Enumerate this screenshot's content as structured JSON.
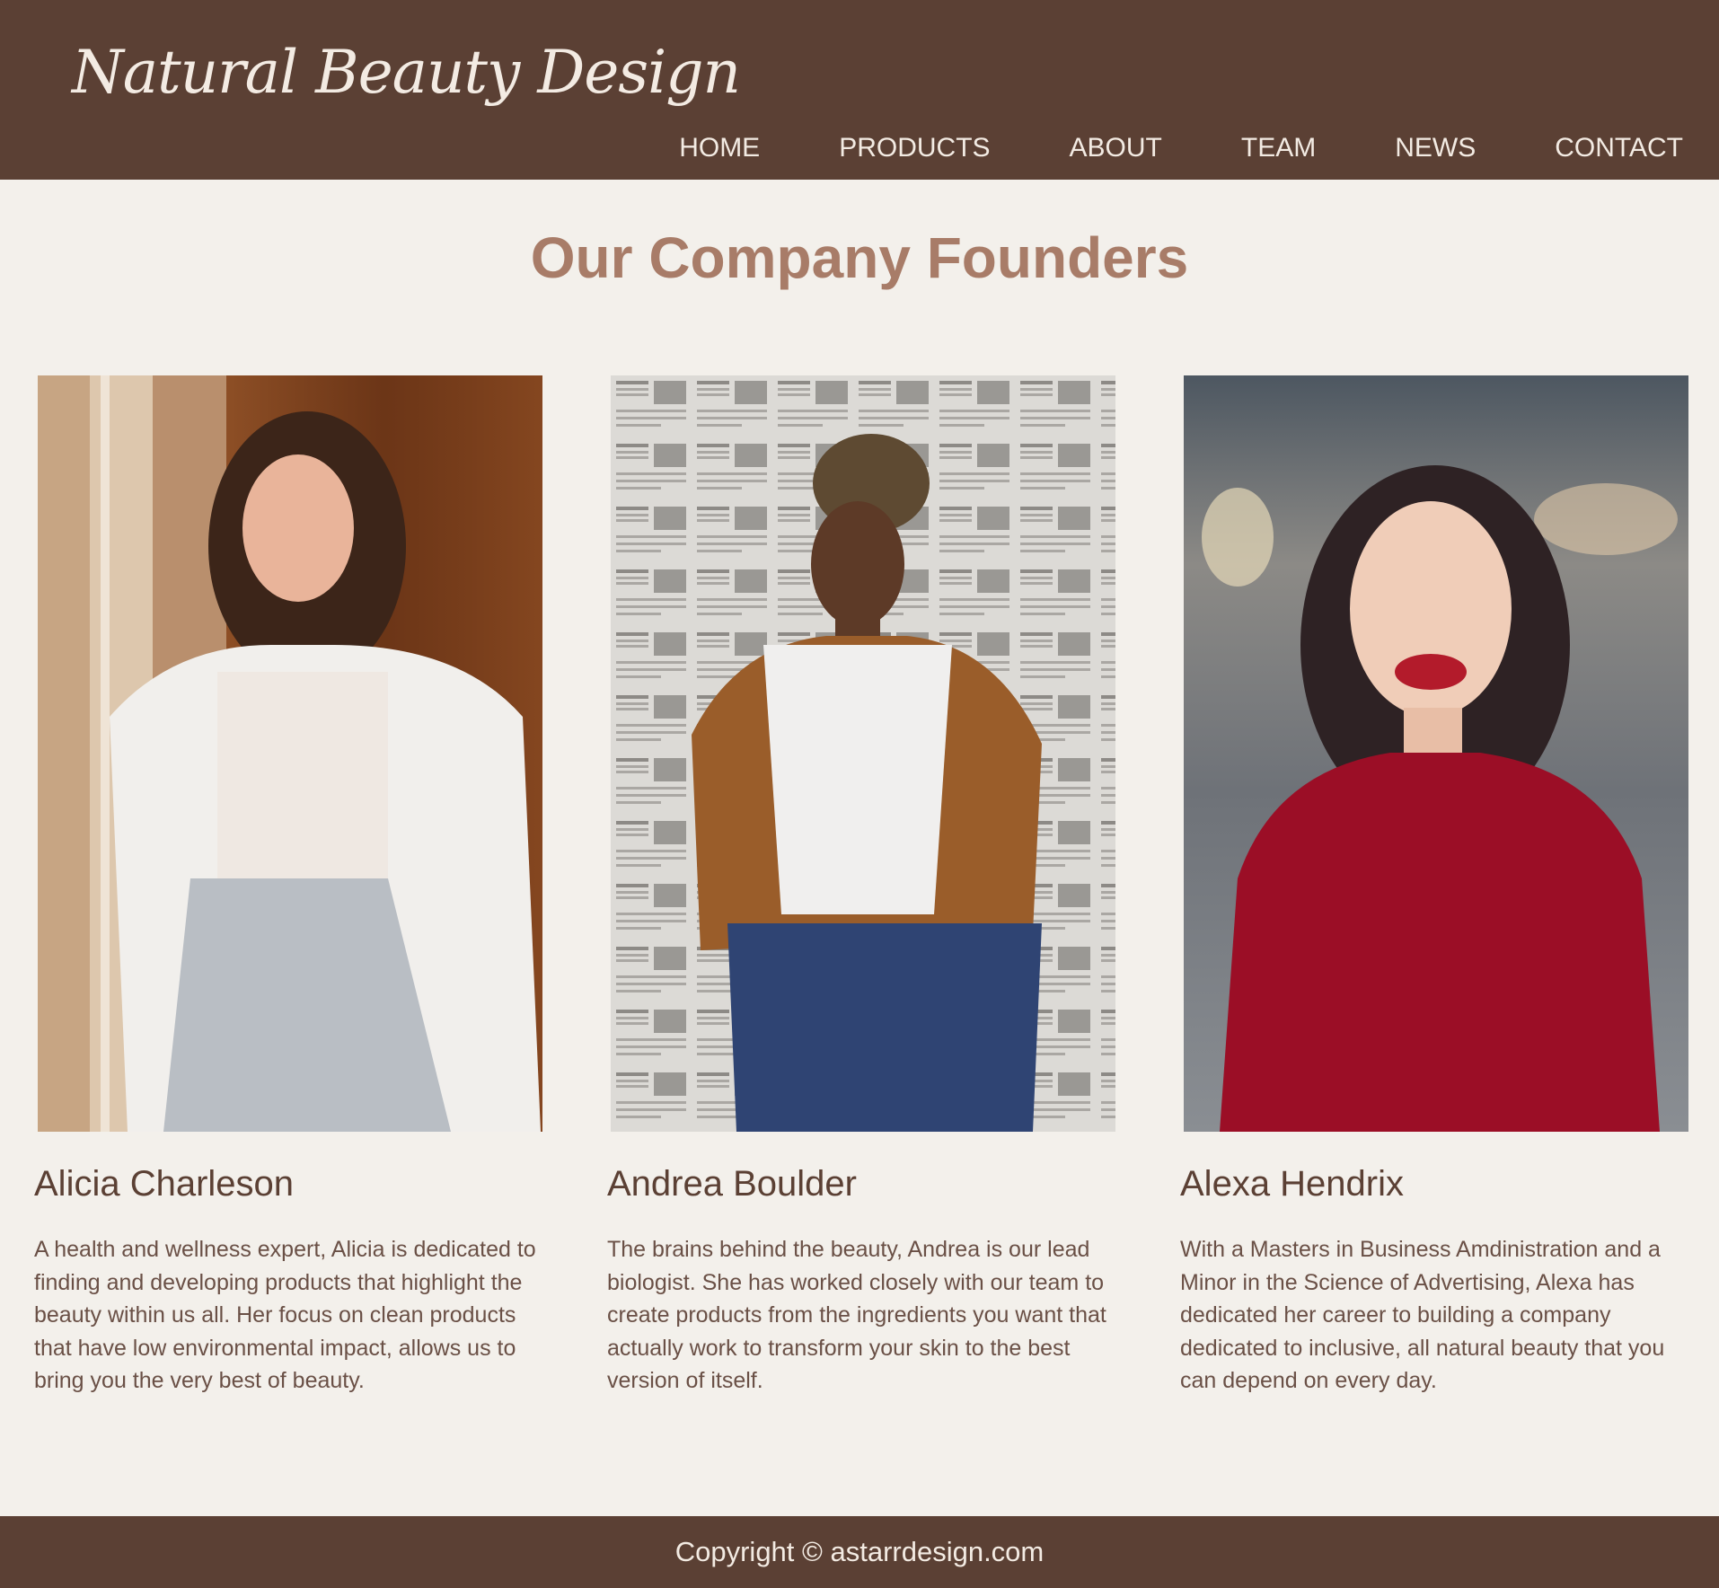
{
  "brand": {
    "logo_text": "Natural Beauty Design"
  },
  "nav": {
    "items": [
      {
        "label": "HOME"
      },
      {
        "label": "PRODUCTS"
      },
      {
        "label": "ABOUT"
      },
      {
        "label": "TEAM"
      },
      {
        "label": "NEWS"
      },
      {
        "label": "CONTACT"
      }
    ]
  },
  "main": {
    "title": "Our Company Founders",
    "founders": [
      {
        "name": "Alicia Charleson",
        "bio": "A health and wellness expert, Alicia is dedicated to finding and developing products that highlight the beauty within us all. Her focus on clean products that have low environmental impact, allows us to bring you the very best of beauty."
      },
      {
        "name": "Andrea Boulder",
        "bio": "The brains behind the beauty, Andrea is our lead biologist. She has worked closely with our team to create products from the ingredients you want that actually work to transform your skin to the best version of itself."
      },
      {
        "name": "Alexa Hendrix",
        "bio": "With a Masters in Business Amdinistration and a Minor in the Science of Advertising, Alexa has dedicated her career to building a company dedicated to inclusive, all natural beauty that you can depend on every day."
      }
    ]
  },
  "footer": {
    "copyright": "Copyright © astarrdesign.com"
  },
  "colors": {
    "header_bg": "#5b4034",
    "page_bg": "#f3f0eb",
    "title": "#a87c68",
    "name": "#5b4034",
    "body_text": "#6a5046"
  }
}
